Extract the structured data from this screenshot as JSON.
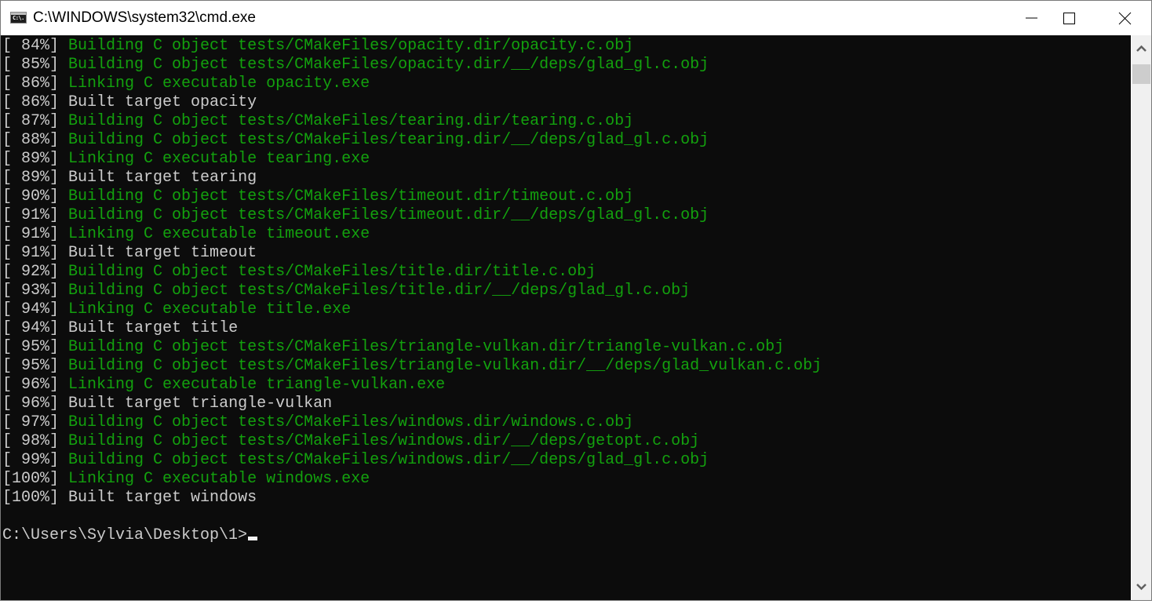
{
  "window": {
    "title": "C:\\WINDOWS\\system32\\cmd.exe",
    "icon_text": "C:\\."
  },
  "colors": {
    "background": "#0c0c0c",
    "green": "#13a10e",
    "gray": "#cccccc"
  },
  "console": {
    "lines": [
      {
        "pct": "[ 84%]",
        "text": "Building C object tests/CMakeFiles/opacity.dir/opacity.c.obj",
        "color": "green"
      },
      {
        "pct": "[ 85%]",
        "text": "Building C object tests/CMakeFiles/opacity.dir/__/deps/glad_gl.c.obj",
        "color": "green"
      },
      {
        "pct": "[ 86%]",
        "text": "Linking C executable opacity.exe",
        "color": "green"
      },
      {
        "pct": "[ 86%]",
        "text": "Built target opacity",
        "color": "gray"
      },
      {
        "pct": "[ 87%]",
        "text": "Building C object tests/CMakeFiles/tearing.dir/tearing.c.obj",
        "color": "green"
      },
      {
        "pct": "[ 88%]",
        "text": "Building C object tests/CMakeFiles/tearing.dir/__/deps/glad_gl.c.obj",
        "color": "green"
      },
      {
        "pct": "[ 89%]",
        "text": "Linking C executable tearing.exe",
        "color": "green"
      },
      {
        "pct": "[ 89%]",
        "text": "Built target tearing",
        "color": "gray"
      },
      {
        "pct": "[ 90%]",
        "text": "Building C object tests/CMakeFiles/timeout.dir/timeout.c.obj",
        "color": "green"
      },
      {
        "pct": "[ 91%]",
        "text": "Building C object tests/CMakeFiles/timeout.dir/__/deps/glad_gl.c.obj",
        "color": "green"
      },
      {
        "pct": "[ 91%]",
        "text": "Linking C executable timeout.exe",
        "color": "green"
      },
      {
        "pct": "[ 91%]",
        "text": "Built target timeout",
        "color": "gray"
      },
      {
        "pct": "[ 92%]",
        "text": "Building C object tests/CMakeFiles/title.dir/title.c.obj",
        "color": "green"
      },
      {
        "pct": "[ 93%]",
        "text": "Building C object tests/CMakeFiles/title.dir/__/deps/glad_gl.c.obj",
        "color": "green"
      },
      {
        "pct": "[ 94%]",
        "text": "Linking C executable title.exe",
        "color": "green"
      },
      {
        "pct": "[ 94%]",
        "text": "Built target title",
        "color": "gray"
      },
      {
        "pct": "[ 95%]",
        "text": "Building C object tests/CMakeFiles/triangle-vulkan.dir/triangle-vulkan.c.obj",
        "color": "green"
      },
      {
        "pct": "[ 95%]",
        "text": "Building C object tests/CMakeFiles/triangle-vulkan.dir/__/deps/glad_vulkan.c.obj",
        "color": "green"
      },
      {
        "pct": "[ 96%]",
        "text": "Linking C executable triangle-vulkan.exe",
        "color": "green"
      },
      {
        "pct": "[ 96%]",
        "text": "Built target triangle-vulkan",
        "color": "gray"
      },
      {
        "pct": "[ 97%]",
        "text": "Building C object tests/CMakeFiles/windows.dir/windows.c.obj",
        "color": "green"
      },
      {
        "pct": "[ 98%]",
        "text": "Building C object tests/CMakeFiles/windows.dir/__/deps/getopt.c.obj",
        "color": "green"
      },
      {
        "pct": "[ 99%]",
        "text": "Building C object tests/CMakeFiles/windows.dir/__/deps/glad_gl.c.obj",
        "color": "green"
      },
      {
        "pct": "[100%]",
        "text": "Linking C executable windows.exe",
        "color": "green"
      },
      {
        "pct": "[100%]",
        "text": "Built target windows",
        "color": "gray"
      }
    ],
    "prompt": "C:\\Users\\Sylvia\\Desktop\\1>"
  },
  "controls": {
    "minimize": "minimize-icon",
    "maximize": "maximize-icon",
    "close": "close-icon"
  }
}
